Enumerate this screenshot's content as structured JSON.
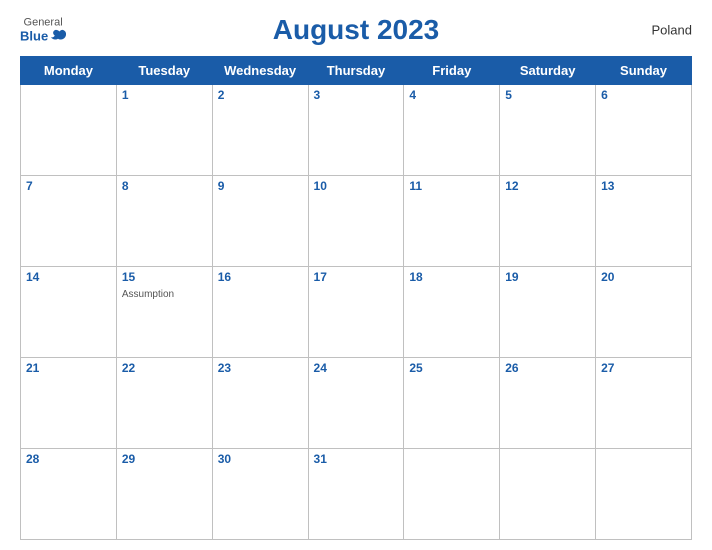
{
  "logo": {
    "general": "General",
    "blue": "Blue"
  },
  "country": "Poland",
  "title": "August 2023",
  "days_header": [
    "Monday",
    "Tuesday",
    "Wednesday",
    "Thursday",
    "Friday",
    "Saturday",
    "Sunday"
  ],
  "weeks": [
    [
      {
        "num": "",
        "empty": true
      },
      {
        "num": "1"
      },
      {
        "num": "2"
      },
      {
        "num": "3"
      },
      {
        "num": "4"
      },
      {
        "num": "5"
      },
      {
        "num": "6"
      }
    ],
    [
      {
        "num": "7"
      },
      {
        "num": "8"
      },
      {
        "num": "9"
      },
      {
        "num": "10"
      },
      {
        "num": "11"
      },
      {
        "num": "12"
      },
      {
        "num": "13"
      }
    ],
    [
      {
        "num": "14"
      },
      {
        "num": "15",
        "holiday": "Assumption"
      },
      {
        "num": "16"
      },
      {
        "num": "17"
      },
      {
        "num": "18"
      },
      {
        "num": "19"
      },
      {
        "num": "20"
      }
    ],
    [
      {
        "num": "21"
      },
      {
        "num": "22"
      },
      {
        "num": "23"
      },
      {
        "num": "24"
      },
      {
        "num": "25"
      },
      {
        "num": "26"
      },
      {
        "num": "27"
      }
    ],
    [
      {
        "num": "28"
      },
      {
        "num": "29"
      },
      {
        "num": "30"
      },
      {
        "num": "31"
      },
      {
        "num": "",
        "empty": true
      },
      {
        "num": "",
        "empty": true
      },
      {
        "num": "",
        "empty": true
      }
    ]
  ]
}
